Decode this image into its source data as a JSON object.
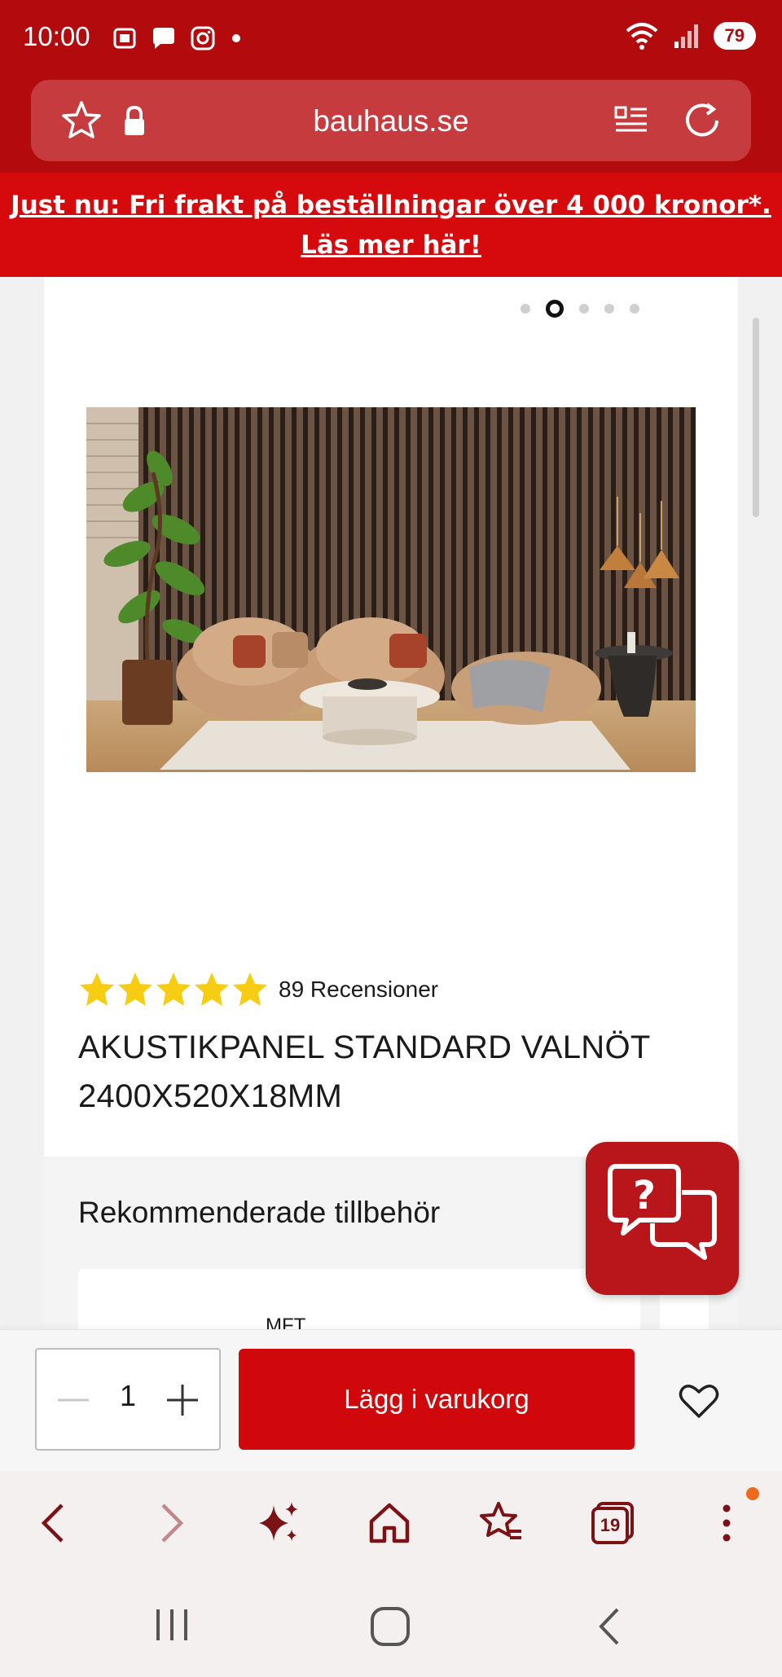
{
  "status_bar": {
    "time": "10:00",
    "battery": "79",
    "icons": [
      "screenshot-icon",
      "chat-bubble-icon",
      "instagram-icon",
      "dot-icon",
      "wifi-icon",
      "signal-icon"
    ]
  },
  "browser": {
    "url": "bauhaus.se",
    "icons": [
      "star-icon",
      "lock-icon",
      "reader-icon",
      "reload-icon"
    ]
  },
  "promo_banner": {
    "text": "Just nu: Fri frakt på beställningar över 4 000 kronor*. Läs mer här!"
  },
  "product": {
    "carousel": {
      "count": 5,
      "active_index": 1
    },
    "rating": {
      "stars": 5,
      "reviews_label": "89 Recensioner"
    },
    "title": "AKUSTIKPANEL STANDARD VALNÖT 2400X520X18MM"
  },
  "recommendations": {
    "title": "Rekommenderade tillbehör",
    "first_card_text": "MFT"
  },
  "cart_bar": {
    "quantity": "1",
    "add_to_cart_label": "Lägg i varukorg"
  },
  "browser_nav": {
    "tabs_count": "19",
    "icons": [
      "back-icon",
      "forward-icon",
      "sparkle-icon",
      "home-icon",
      "bookmarks-icon",
      "tabs-icon",
      "more-icon"
    ]
  },
  "colors": {
    "brand_red": "#d6090c",
    "bar_red": "#b20a0d",
    "star_yellow": "#f7cd14",
    "nav_dark_red": "#7a1216"
  }
}
